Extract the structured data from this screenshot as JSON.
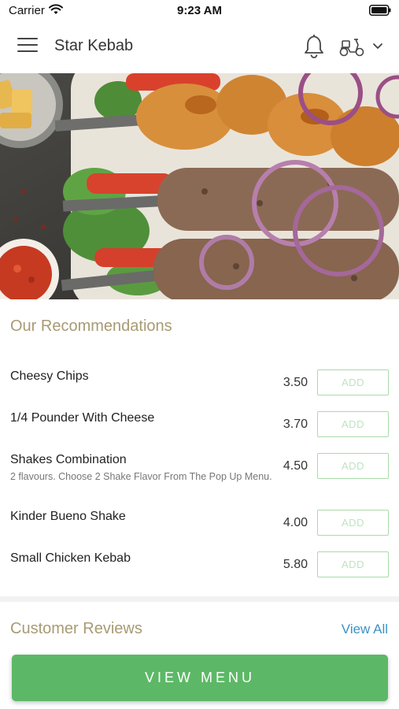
{
  "status_bar": {
    "carrier": "Carrier",
    "time": "9:23 AM"
  },
  "header": {
    "title": "Star Kebab",
    "icons": [
      "menu-icon",
      "bell-icon",
      "scooter-icon",
      "chevron-down-icon"
    ]
  },
  "hero": {
    "image": "kebab-platter-photo"
  },
  "recommendations": {
    "title": "Our Recommendations",
    "add_label": "ADD",
    "items": [
      {
        "name": "Cheesy Chips",
        "description": "",
        "price": "3.50"
      },
      {
        "name": "1/4 Pounder With Cheese",
        "description": "",
        "price": "3.70"
      },
      {
        "name": "Shakes Combination",
        "description": "2 flavours. Choose 2 Shake Flavor From The Pop Up Menu.",
        "price": "4.50"
      },
      {
        "name": "Kinder Bueno Shake",
        "description": "",
        "price": "4.00"
      },
      {
        "name": "Small Chicken Kebab",
        "description": "",
        "price": "5.80"
      }
    ]
  },
  "reviews": {
    "title": "Customer Reviews",
    "view_all": "View All"
  },
  "footer": {
    "view_menu": "VIEW MENU"
  },
  "colors": {
    "accent_green": "#5cb866",
    "section_title": "#a89a73",
    "link_blue": "#3b93c4",
    "add_border": "#a9dca9"
  }
}
